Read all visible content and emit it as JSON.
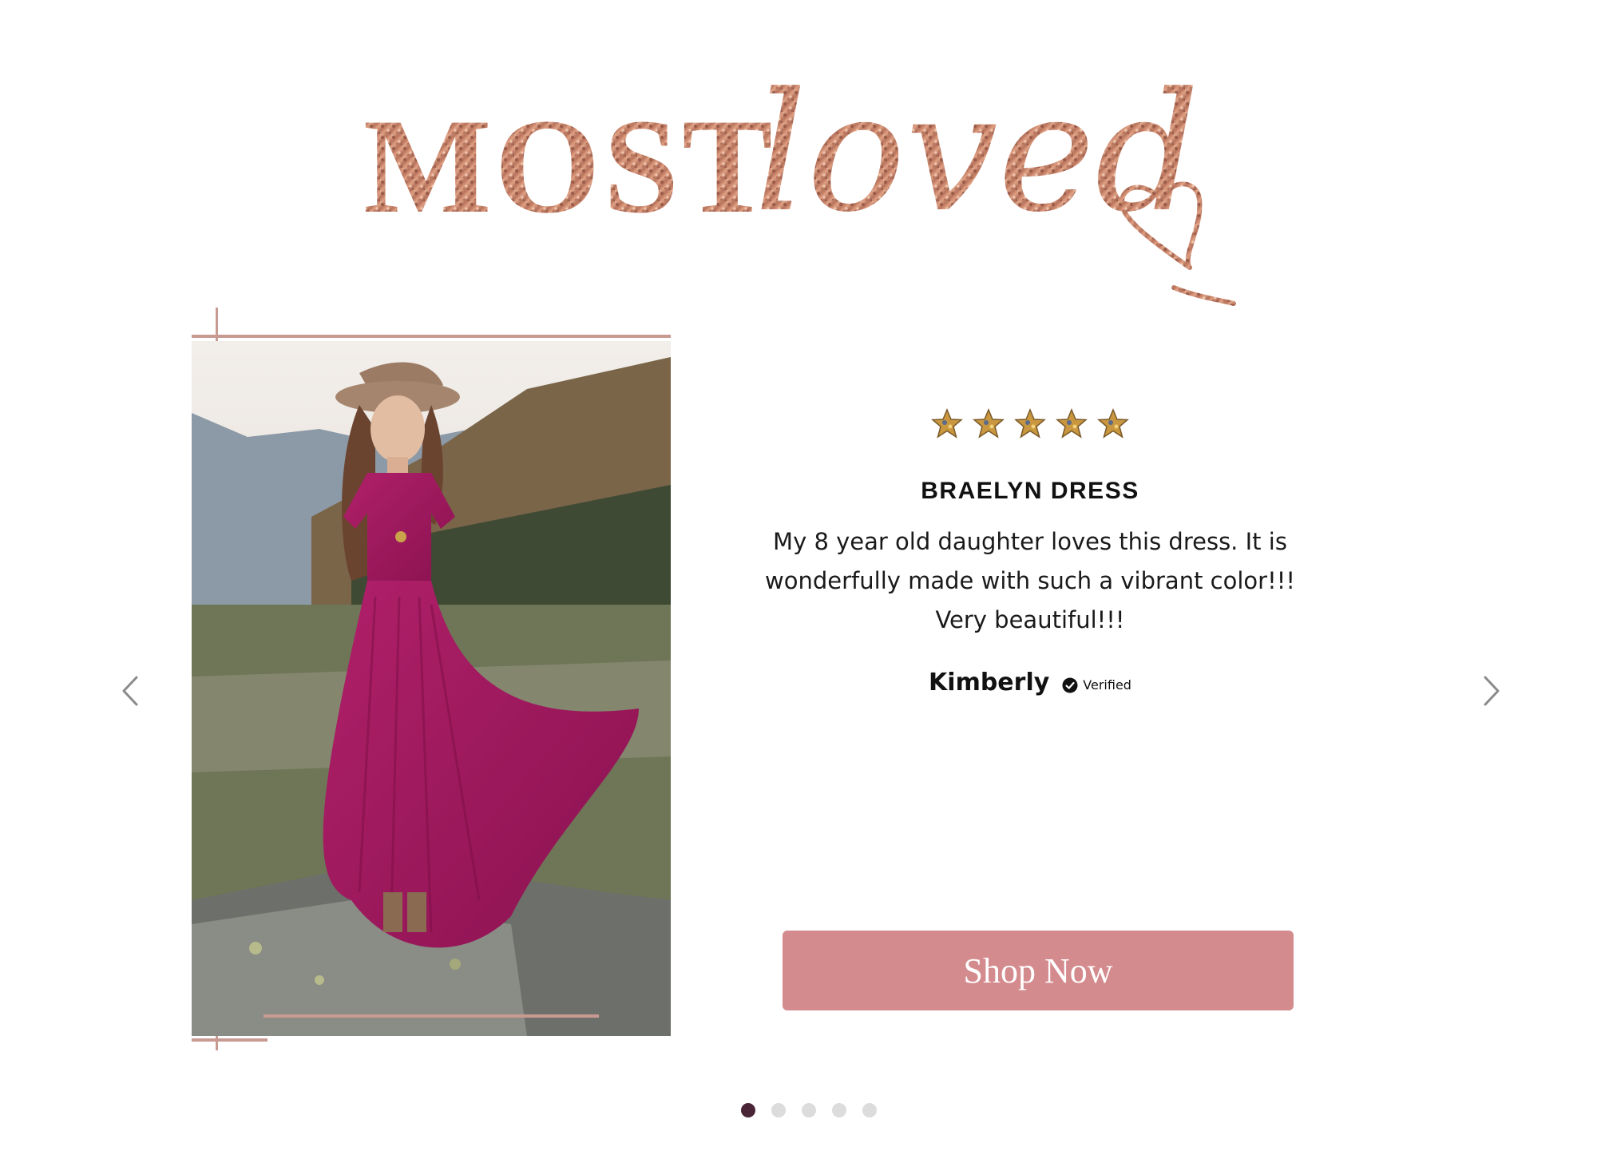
{
  "heading": {
    "word_most": "MOST",
    "word_loved": "loved",
    "icon": "heart-icon"
  },
  "photo": {
    "alt": "girl-in-magenta-dress-photo"
  },
  "review": {
    "rating": 5,
    "max_rating": 5,
    "star_icon": "star-icon",
    "product_name": "BRAELYN DRESS",
    "text": "My 8 year old daughter loves this dress. It is wonderfully made with such a vibrant color!!! Very beautiful!!!",
    "reviewer": "Kimberly",
    "verified_icon": "check-circle-icon",
    "verified_label": "Verified"
  },
  "cta": {
    "shop_label": "Shop Now"
  },
  "carousel": {
    "prev_icon": "chevron-left-icon",
    "next_icon": "chevron-right-icon",
    "slide_count": 5,
    "active_index": 0
  },
  "colors": {
    "rose_gold": "#b8735c",
    "button": "#d48b8e",
    "dot_active": "#4a2437",
    "dot_inactive": "#dcdcdc",
    "dress": "#a3175d"
  }
}
